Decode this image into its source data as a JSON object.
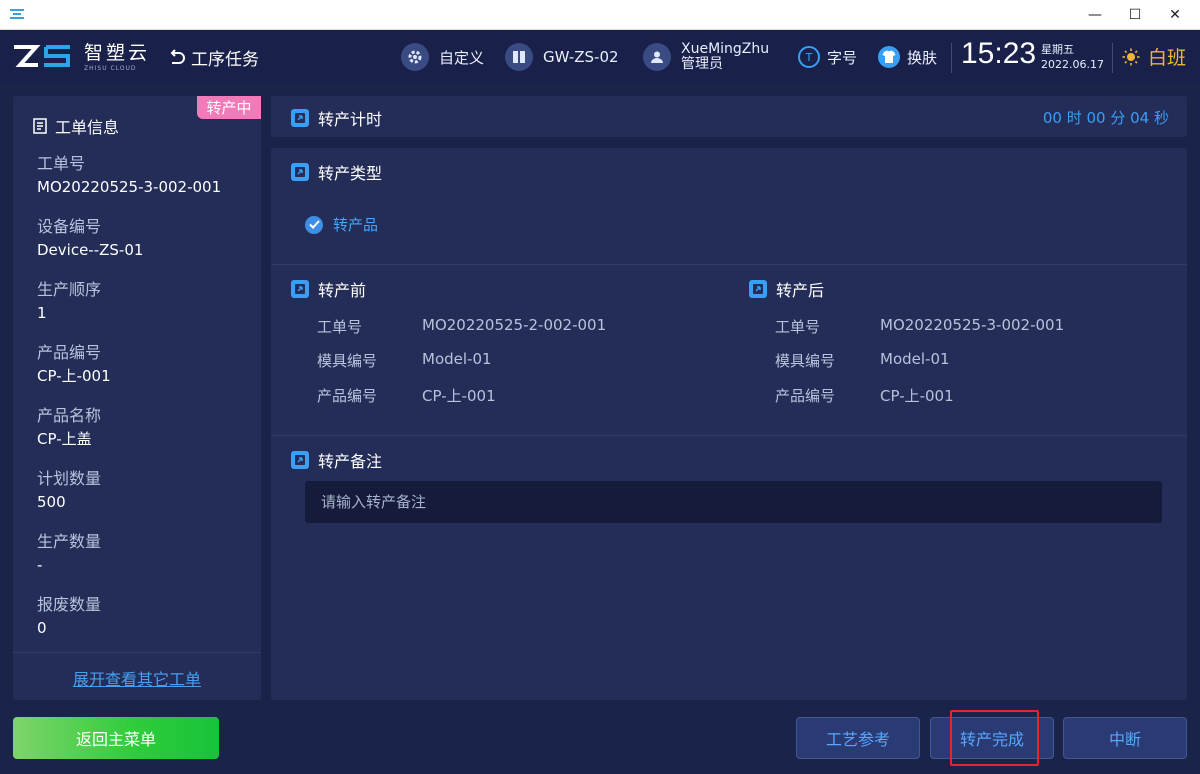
{
  "window": {
    "minimize": "—",
    "maximize": "☐",
    "close": "✕"
  },
  "header": {
    "logo_cn": "智塑云",
    "logo_en": "ZHISU CLOUD",
    "back_label": "工序任务",
    "custom_label": "自定义",
    "device_label": "GW-ZS-02",
    "user_name": "XueMingZhu",
    "user_role": "管理员",
    "font_label": "字号",
    "skin_label": "换肤",
    "time": "15:23",
    "weekday": "星期五",
    "date": "2022.06.17",
    "shift": "白班"
  },
  "order_info": {
    "title": "工单信息",
    "status": "转产中",
    "fields": [
      {
        "label": "工单号",
        "value": "MO20220525-3-002-001"
      },
      {
        "label": "设备编号",
        "value": "Device--ZS-01"
      },
      {
        "label": "生产顺序",
        "value": "1"
      },
      {
        "label": "产品编号",
        "value": "CP-上-001"
      },
      {
        "label": "产品名称",
        "value": "CP-上盖"
      },
      {
        "label": "计划数量",
        "value": "500"
      },
      {
        "label": "生产数量",
        "value": "-"
      },
      {
        "label": "报废数量",
        "value": "0"
      }
    ],
    "expand_link": "展开查看其它工单"
  },
  "timer_section": {
    "title": "转产计时",
    "value": "00 时 00 分 04 秒"
  },
  "type_section": {
    "title": "转产类型",
    "selected": "转产品"
  },
  "before": {
    "title": "转产前",
    "rows": [
      {
        "label": "工单号",
        "value": "MO20220525-2-002-001"
      },
      {
        "label": "模具编号",
        "value": "Model-01"
      },
      {
        "label": "产品编号",
        "value": "CP-上-001"
      }
    ]
  },
  "after": {
    "title": "转产后",
    "rows": [
      {
        "label": "工单号",
        "value": "MO20220525-3-002-001"
      },
      {
        "label": "模具编号",
        "value": "Model-01"
      },
      {
        "label": "产品编号",
        "value": "CP-上-001"
      }
    ]
  },
  "remark": {
    "title": "转产备注",
    "placeholder": "请输入转产备注"
  },
  "footer": {
    "back_main": "返回主菜单",
    "process_ref": "工艺参考",
    "complete": "转产完成",
    "interrupt": "中断"
  },
  "colors": {
    "background": "#1a2348",
    "panel": "#232d58",
    "accent_blue": "#3b9ef5",
    "status_pink": "#f27ab8",
    "shift_gold": "#f0b437",
    "highlight_red": "#e8232b",
    "green_button": "#2ecc3a"
  },
  "icons": [
    "app-icon",
    "logo-mark",
    "back-arrow-icon",
    "gear-icon",
    "device-icon",
    "user-icon",
    "font-size-icon",
    "tshirt-icon",
    "sun-icon",
    "document-icon",
    "section-icon",
    "check-icon"
  ]
}
